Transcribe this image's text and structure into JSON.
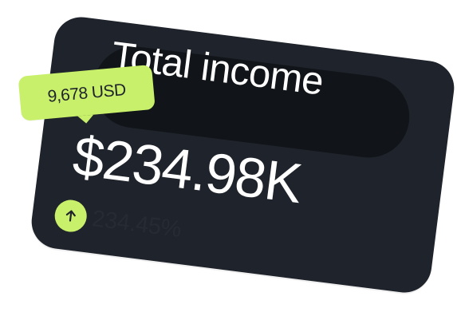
{
  "card": {
    "title": "Total income",
    "amount": "$234.98K",
    "trend": {
      "value": "234.45%",
      "icon": "arrow-up-circle-icon"
    }
  },
  "tooltip": {
    "value": "9,678 USD"
  },
  "colors": {
    "card_bg": "#1f232b",
    "pill_bg": "#111418",
    "accent": "#c8f06a",
    "text_primary": "#ffffff",
    "text_muted": "#262b33"
  }
}
